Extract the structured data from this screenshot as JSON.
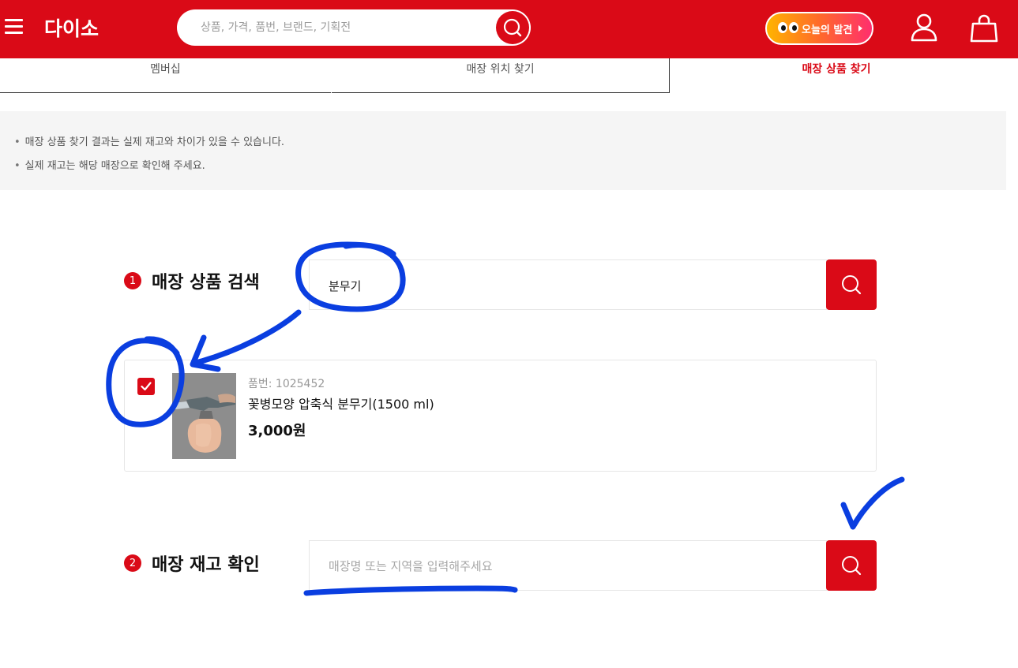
{
  "header": {
    "logo": "다이소",
    "search_placeholder": "상품, 가격, 품번, 브랜드, 기획전",
    "discover_label": "오늘의 발견"
  },
  "tabs": [
    {
      "label": "멤버십"
    },
    {
      "label": "매장 위치 찾기"
    },
    {
      "label": "매장 상품 찾기"
    }
  ],
  "notice": [
    "매장 상품 찾기 결과는 실제 재고와 차이가 있을 수 있습니다.",
    "실제 재고는 해당 매장으로 확인해 주세요."
  ],
  "step1": {
    "num": "1",
    "title": "매장 상품 검색",
    "input_value": "분무기"
  },
  "product": {
    "code": "품번: 1025452",
    "name": "꽃병모양 압축식 분무기(1500 ml)",
    "price": "3,000원"
  },
  "step2": {
    "num": "2",
    "title": "매장 재고 확인",
    "input_placeholder": "매장명 또는 지역을 입력해주세요"
  },
  "colors": {
    "brand": "#da0a17",
    "annotation": "#0a3ee0"
  }
}
